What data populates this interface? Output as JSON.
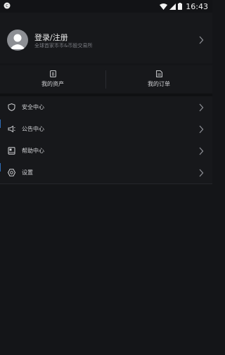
{
  "status_bar": {
    "time": "16:43"
  },
  "profile": {
    "title": "登录/注册",
    "subtitle": "全球首家币币&币股交易所"
  },
  "quick_actions": [
    {
      "label": "我的资产",
      "icon": "wallet-icon"
    },
    {
      "label": "我的订单",
      "icon": "document-icon"
    }
  ],
  "menu": [
    {
      "label": "安全中心",
      "icon": "shield-icon"
    },
    {
      "label": "公告中心",
      "icon": "megaphone-icon"
    },
    {
      "label": "帮助中心",
      "icon": "book-icon"
    },
    {
      "label": "设置",
      "icon": "settings-icon"
    }
  ],
  "colors": {
    "background": "#141518",
    "panel": "#17181b",
    "text": "#d8d9dc",
    "muted": "#7a7c82"
  }
}
